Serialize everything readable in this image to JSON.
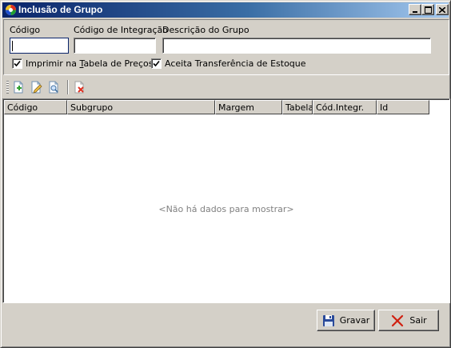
{
  "window": {
    "title": "Inclusão de Grupo"
  },
  "form": {
    "codigo_label": "Código",
    "codigo_value": "",
    "codigo_integracao_label": "Código de Integração",
    "codigo_integracao_value": "",
    "descricao_label": "Descrição do Grupo",
    "descricao_value": "",
    "imprimir_label_pre": "Imprimir na ",
    "imprimir_label_accel": "T",
    "imprimir_label_post": "abela de Preços",
    "imprimir_checked": true,
    "aceita_label": "Aceita Transferência de Estoque",
    "aceita_checked": true
  },
  "toolbar": {
    "icons": [
      "add-icon",
      "edit-icon",
      "view-icon",
      "delete-icon"
    ]
  },
  "grid": {
    "columns": [
      "Código",
      "Subgrupo",
      "Margem",
      "Tabela",
      "Cód.Integr.",
      "Id"
    ],
    "rows": [],
    "empty_message": "<Não há dados para mostrar>"
  },
  "buttons": {
    "gravar_label": "Gravar",
    "sair_label": "Sair"
  },
  "colors": {
    "title_active": "#0a246a",
    "face": "#d4d0c8",
    "empty_text": "#808080"
  }
}
